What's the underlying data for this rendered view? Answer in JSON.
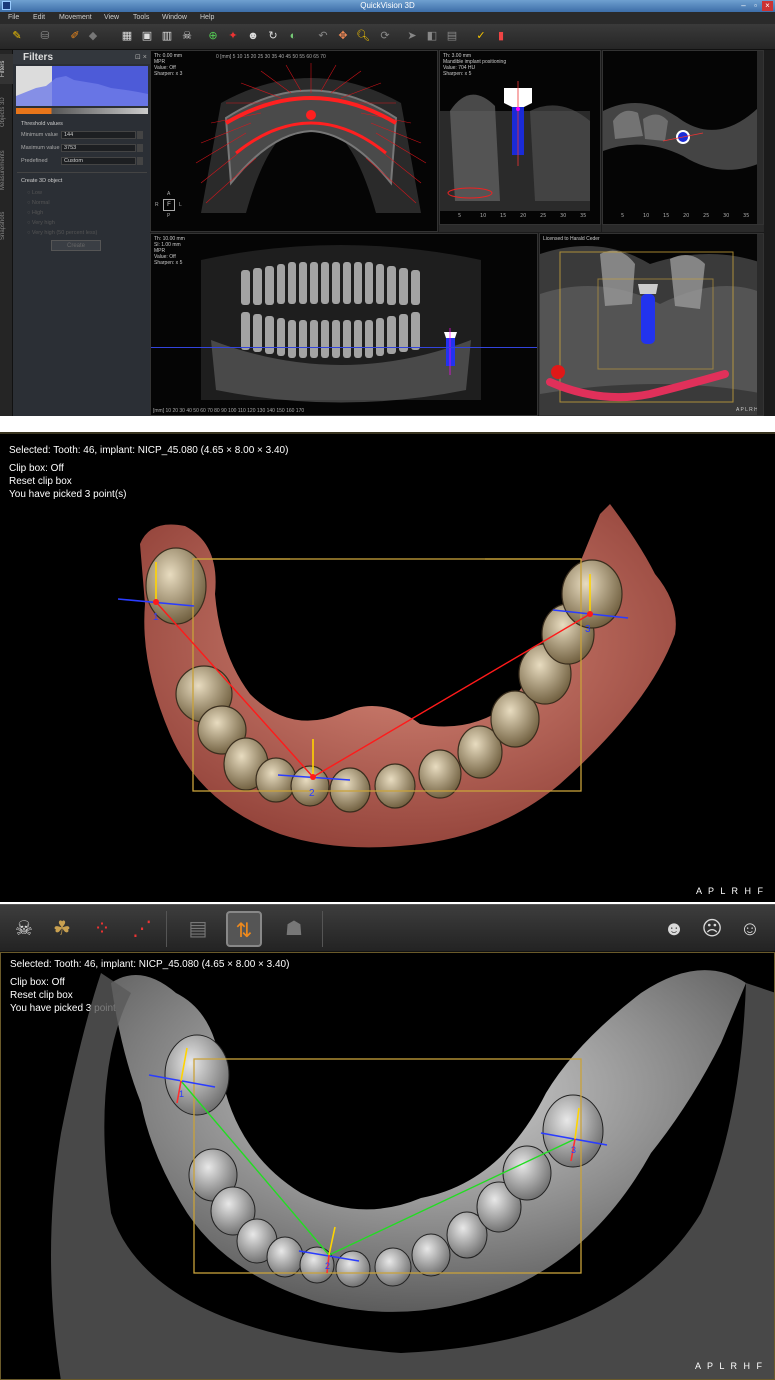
{
  "app": {
    "title": "QuickVision 3D",
    "menu": [
      "File",
      "Edit",
      "Movement",
      "View",
      "Tools",
      "Window",
      "Help"
    ],
    "side_tabs": [
      "Filters",
      "Objects 3D",
      "Measurements",
      "Snapshots"
    ],
    "filters": {
      "title": "Filters",
      "threshold_label": "Threshold values",
      "min_label": "Minimum value",
      "min_value": "144",
      "max_label": "Maximum value",
      "max_value": "3753",
      "predefined_label": "Predefined",
      "predefined_value": "Custom",
      "create_label": "Create 3D object",
      "options": [
        "Low",
        "Normal",
        "High",
        "Very high",
        "Very high (50 percent less)"
      ],
      "create_button": "Create"
    },
    "axial_view": {
      "info": [
        "Th: 0.00 mm",
        "MPR",
        "Value: Off",
        "Sharpen: x 3"
      ],
      "ruler_label": "0 [mm] 5 10 15 20 25 30 35 40 45 50 55 60 65 70",
      "orient": {
        "top": "A",
        "left": "R",
        "center": "F",
        "right": "L",
        "bottom": "P"
      }
    },
    "cross_view": {
      "info": [
        "Th: 3.00 mm",
        "Mandible implant positioning",
        "Value: 704 HU",
        "Sharpen: x 5"
      ],
      "ruler_label": "0 5 10 15 20 25 30 35"
    },
    "sagittal_view": {
      "ruler_label": "0 5 10 15 20 25 30 35"
    },
    "pano_view": {
      "info": [
        "Th: 10.00 mm",
        "Sl: 1.00 mm",
        "MPR",
        "Value: Off",
        "Sharpen: x 5"
      ],
      "ruler_label": "[mm] 10 20 30 40 50 60 70 80 90 100 110 120 130 140 150 160 170"
    },
    "render_view": {
      "info": "Licensed to Harald Ceder",
      "orient": "A P L R H F"
    }
  },
  "mid_panel": {
    "selected": "Selected: Tooth: 46, implant: NICP_45.080 (4.65 × 8.00 × 3.40)",
    "clip": "Clip box: Off",
    "reset": "Reset clip box",
    "picked": "You have picked 3 point(s)",
    "orient": "A P L R H F",
    "points": [
      "1",
      "2",
      "3"
    ]
  },
  "bottom_panel": {
    "selected": "Selected: Tooth: 46, implant: NICP_45.080 (4.65 × 8.00 × 3.40)",
    "clip": "Clip box: Off",
    "reset": "Reset clip box",
    "picked": "You have picked 3 point(s)",
    "orient": "A P L R H F",
    "points": [
      "1",
      "2",
      "3"
    ]
  },
  "colors": {
    "accent_orange": "#e8751a",
    "line_red": "#ff1a1a",
    "line_green": "#22dd22",
    "axis_blue": "#2a3cff",
    "axis_yellow": "#ffd400",
    "clip_box": "#c9a23a"
  }
}
